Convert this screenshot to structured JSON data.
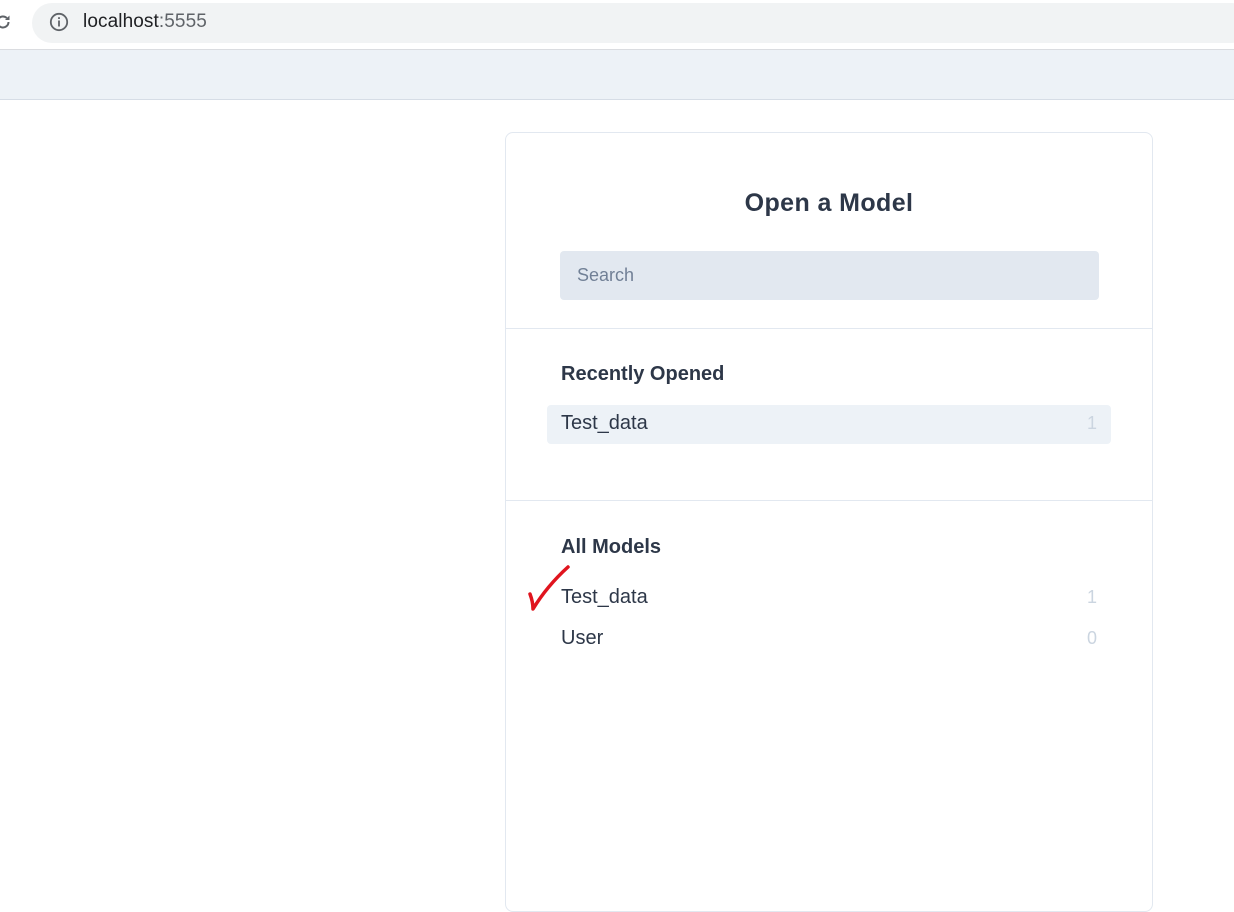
{
  "browser": {
    "url_host": "localhost",
    "url_port": ":5555"
  },
  "modal": {
    "title": "Open a Model",
    "search": {
      "placeholder": "Search",
      "value": ""
    },
    "recent": {
      "title": "Recently Opened",
      "items": [
        {
          "name": "Test_data",
          "count": "1"
        }
      ]
    },
    "all": {
      "title": "All Models",
      "items": [
        {
          "name": "Test_data",
          "count": "1"
        },
        {
          "name": "User",
          "count": "0"
        }
      ]
    }
  },
  "colors": {
    "annotation_checkmark": "#e0141e",
    "header_bg": "#edf2f7",
    "search_bg": "#e2e8f0"
  },
  "icons": {
    "reload": "reload-icon",
    "info": "info-icon",
    "annotation": "checkmark-icon"
  }
}
